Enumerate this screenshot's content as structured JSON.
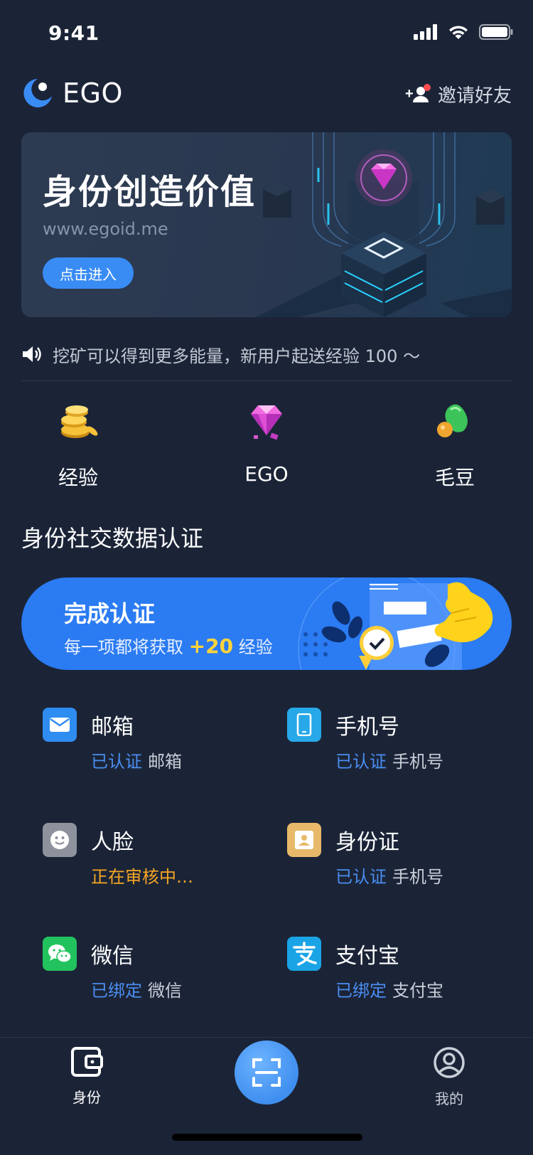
{
  "status": {
    "time": "9:41"
  },
  "header": {
    "brand": "EGO",
    "invite_label": "邀请好友"
  },
  "banner": {
    "title": "身份创造价值",
    "url": "www.egoid.me",
    "button_label": "点击进入"
  },
  "notice": {
    "text": "挖矿可以得到更多能量，新用户起送经验 100 ～"
  },
  "assets": [
    {
      "label": "经验",
      "icon": "coins-icon"
    },
    {
      "label": "EGO",
      "icon": "gem-icon"
    },
    {
      "label": "毛豆",
      "icon": "bean-icon"
    }
  ],
  "section_title": "身份社交数据认证",
  "promo": {
    "title": "完成认证",
    "sub_prefix": "每一项都将获取",
    "bonus": "+20",
    "sub_suffix": "经验"
  },
  "verifications": [
    {
      "title": "邮箱",
      "status": "已认证",
      "status_type": "verified",
      "detail": "邮箱",
      "icon": "mail-icon",
      "color": "#2f8cf0"
    },
    {
      "title": "手机号",
      "status": "已认证",
      "status_type": "verified",
      "detail": "手机号",
      "icon": "phone-icon",
      "color": "#27a8e8"
    },
    {
      "title": "人脸",
      "status": "正在审核中…",
      "status_type": "pending",
      "detail": "",
      "icon": "face-icon",
      "color": "#8e929c"
    },
    {
      "title": "身份证",
      "status": "已认证",
      "status_type": "verified",
      "detail": "手机号",
      "icon": "id-card-icon",
      "color": "#e8b96a"
    },
    {
      "title": "微信",
      "status": "已绑定",
      "status_type": "verified",
      "detail": "微信",
      "icon": "wechat-icon",
      "color": "#22c35e"
    },
    {
      "title": "支付宝",
      "status": "已绑定",
      "status_type": "verified",
      "detail": "支付宝",
      "icon": "alipay-icon",
      "color": "#1aa4e6"
    }
  ],
  "tabs": [
    {
      "label": "身份",
      "icon": "wallet-icon"
    },
    {
      "label": "",
      "icon": "scan-icon"
    },
    {
      "label": "我的",
      "icon": "user-icon"
    }
  ],
  "colors": {
    "background": "#1b2437",
    "accent": "#3a8cf5",
    "verified": "#4a8ef0",
    "pending": "#f5a623",
    "bonus": "#ffd43b"
  }
}
